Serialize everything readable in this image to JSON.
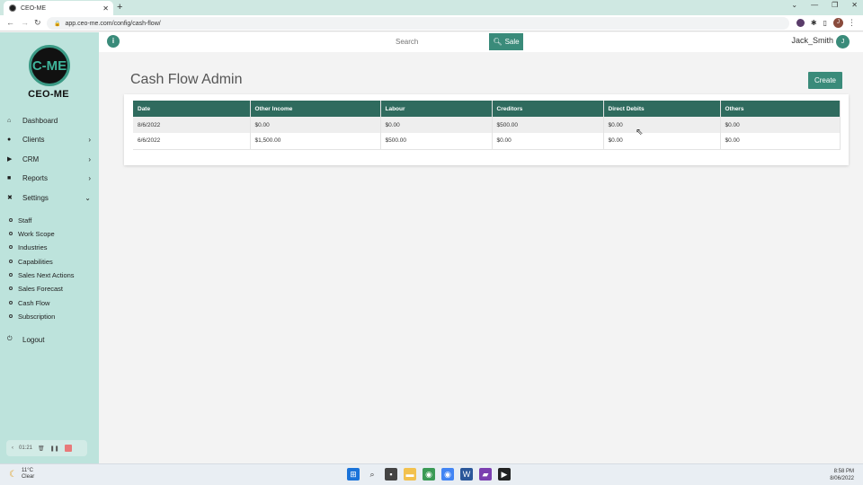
{
  "browser": {
    "tab_title": "CEO-ME",
    "new_tab": "+",
    "url": "app.ceo-me.com/config/cash-flow/",
    "profile_initial": "J"
  },
  "logo": {
    "mark": "C-ME",
    "text": "CEO-ME"
  },
  "sidebar": {
    "items": [
      {
        "label": "Dashboard",
        "icon": "home-icon"
      },
      {
        "label": "Clients",
        "icon": "clients-icon",
        "chevron": "›"
      },
      {
        "label": "CRM",
        "icon": "crm-icon",
        "chevron": "›"
      },
      {
        "label": "Reports",
        "icon": "reports-icon",
        "chevron": "›"
      },
      {
        "label": "Settings",
        "icon": "wrench-icon",
        "chevron": "⌄"
      }
    ],
    "settings_sub": [
      "Staff",
      "Work Scope",
      "Industries",
      "Capabilities",
      "Sales Next Actions",
      "Sales Forecast",
      "Cash Flow",
      "Subscription"
    ],
    "logout": "Logout"
  },
  "recorder": {
    "time": "01:21"
  },
  "topbar": {
    "search_placeholder": "Search",
    "sale_label": "Sale",
    "user_name": "Jack_Smith",
    "user_initial": "J"
  },
  "main": {
    "title": "Cash Flow Admin",
    "create_label": "Create",
    "columns": [
      "Date",
      "Other Income",
      "Labour",
      "Creditors",
      "Direct Debits",
      "Others"
    ],
    "rows": [
      [
        "8/6/2022",
        "$0.00",
        "$0.00",
        "$500.00",
        "$0.00",
        "$0.00"
      ],
      [
        "6/6/2022",
        "$1,500.00",
        "$500.00",
        "$0.00",
        "$0.00",
        "$0.00"
      ]
    ]
  },
  "taskbar": {
    "weather_temp": "11°C",
    "weather_desc": "Clear",
    "time": "8:58 PM",
    "date": "8/06/2022"
  },
  "colors": {
    "accent": "#3a8b7a",
    "sidebar": "#bde3dc",
    "table_header": "#2f6b5e"
  }
}
